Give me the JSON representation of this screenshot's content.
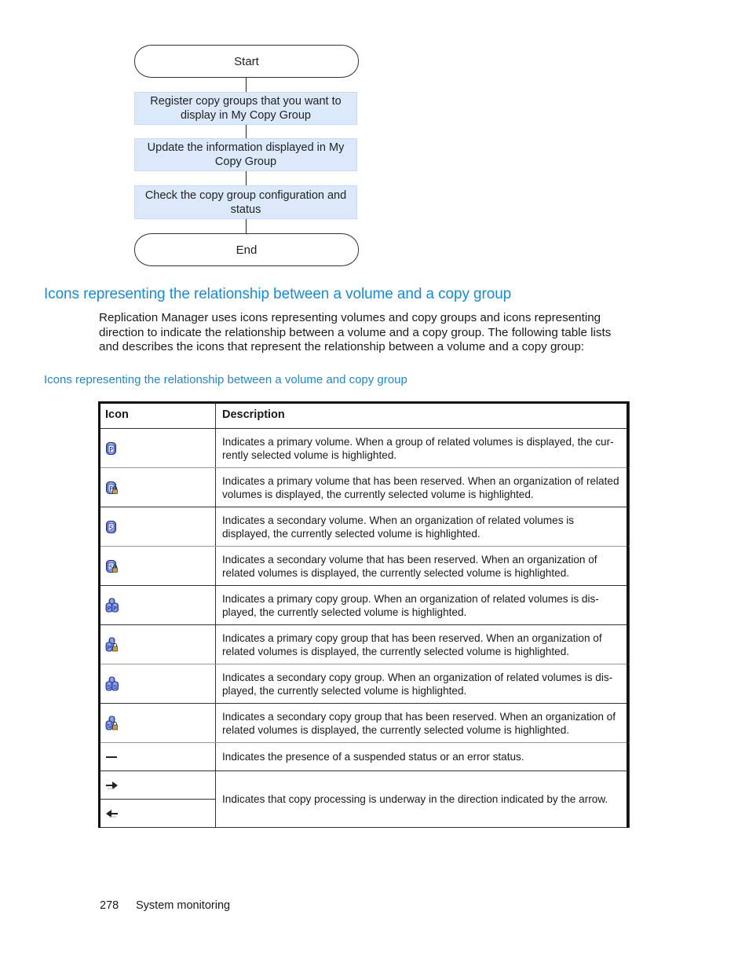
{
  "flowchart": {
    "start": "Start",
    "steps": [
      "Register copy groups that you want to display in My Copy Group",
      "Update the information displayed in My Copy Group",
      "Check the copy group configuration and status"
    ],
    "end": "End"
  },
  "section": {
    "heading": "Icons representing the relationship between a volume and a copy group",
    "paragraph": "Replication Manager uses icons representing volumes and copy groups and icons representing direction to indicate the relationship between a volume and a copy group. The following table lists and describes the icons that represent the relationship between a volume and a copy group:",
    "table_caption": "Icons representing the relationship between a volume and copy group"
  },
  "table": {
    "headers": {
      "icon": "Icon",
      "description": "Description"
    },
    "rows": [
      {
        "icon": "primary-volume-icon",
        "description": "Indicates a primary volume. When a group of related volumes is displayed, the cur-rently selected volume is highlighted."
      },
      {
        "icon": "primary-volume-reserved-icon",
        "description": "Indicates a primary volume that has been reserved. When an organization of related volumes is displayed, the currently selected volume is highlighted."
      },
      {
        "icon": "secondary-volume-icon",
        "description": "Indicates a secondary volume. When an organization of related volumes is displayed, the currently selected volume is highlighted."
      },
      {
        "icon": "secondary-volume-reserved-icon",
        "description": "Indicates a secondary volume that has been reserved. When an organization of related volumes is displayed, the currently selected volume is highlighted."
      },
      {
        "icon": "primary-copy-group-icon",
        "description": "Indicates a primary copy group. When an organization of related volumes is dis-played, the currently selected volume is highlighted."
      },
      {
        "icon": "primary-copy-group-reserved-icon",
        "description": "Indicates a primary copy group that has been reserved. When an organization of related volumes is displayed, the currently selected volume is highlighted."
      },
      {
        "icon": "secondary-copy-group-icon",
        "description": "Indicates a secondary copy group. When an organization of related volumes is dis-played, the currently selected volume is highlighted."
      },
      {
        "icon": "secondary-copy-group-reserved-icon",
        "description": "Indicates a secondary copy group that has been reserved. When an organization of related volumes is displayed, the currently selected volume is highlighted."
      },
      {
        "icon": "suspended-error-status-icon",
        "description": "Indicates the presence of a suspended status or an error status."
      },
      {
        "icon": "copy-direction-arrow-icons",
        "icons": [
          "arrow-right-icon",
          "arrow-left-icon"
        ],
        "description": "Indicates that copy processing is underway in the direction indicated by the arrow."
      }
    ]
  },
  "footer": {
    "page_number": "278",
    "section_title": "System monitoring"
  },
  "colors": {
    "heading_blue": "#1b8ad0",
    "flow_step_fill": "#dce9fb",
    "icon_blue": "#6a84e8",
    "lock_gold": "#c8a040"
  }
}
